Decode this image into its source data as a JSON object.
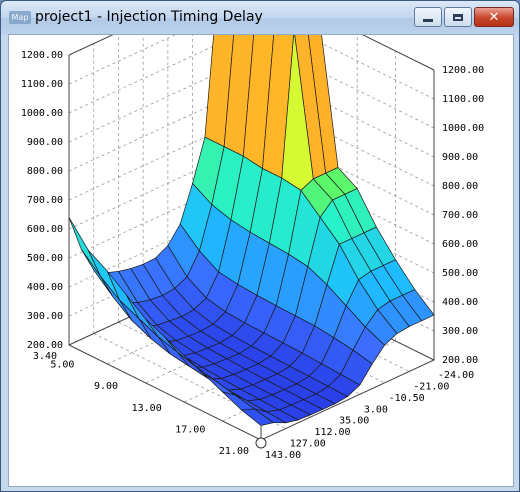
{
  "window": {
    "app_icon_text": "Map",
    "title": "project1 - Injection Timing Delay",
    "controls": {
      "minimize": "minimize",
      "maximize": "maximize",
      "close": "close"
    }
  },
  "chart_data": {
    "type": "surface",
    "title": "",
    "xlabel": "",
    "ylabel": "",
    "zlabel": "",
    "zlim": [
      200,
      1200
    ],
    "grid": true,
    "z_ticks": [
      "200.00",
      "300.00",
      "400.00",
      "500.00",
      "600.00",
      "700.00",
      "800.00",
      "900.00",
      "1000.00",
      "1100.00",
      "1200.00"
    ],
    "x_ticks": [
      "3.40",
      "5.00",
      "9.00",
      "13.00",
      "17.00",
      "21.00"
    ],
    "y_ticks": [
      "143.00",
      "127.00",
      "112.00",
      "35.00",
      "3.00",
      "-10.50",
      "-21.00",
      "-24.00"
    ],
    "x": [
      3.4,
      4.2,
      5.0,
      7.0,
      9.0,
      11.0,
      13.0,
      15.0,
      17.0,
      19.0,
      21.0
    ],
    "y": [
      143,
      135,
      127,
      120,
      112,
      74,
      35,
      19,
      3,
      -3.75,
      -10.5,
      -15.75,
      -21,
      -22.5,
      -24
    ],
    "z": [
      [
        640,
        510,
        420,
        390,
        375,
        365,
        360,
        362,
        385,
        440,
        560,
        700,
        1180,
        1195,
        1200
      ],
      [
        560,
        450,
        360,
        320,
        300,
        290,
        285,
        290,
        310,
        380,
        520,
        700,
        1180,
        1195,
        1200
      ],
      [
        520,
        400,
        310,
        270,
        255,
        250,
        245,
        250,
        270,
        340,
        500,
        700,
        1180,
        1195,
        1200
      ],
      [
        470,
        370,
        280,
        250,
        235,
        230,
        228,
        232,
        255,
        330,
        490,
        690,
        1180,
        1195,
        1200
      ],
      [
        420,
        340,
        260,
        235,
        225,
        222,
        220,
        226,
        250,
        325,
        485,
        690,
        1180,
        1195,
        1200
      ],
      [
        390,
        320,
        250,
        228,
        220,
        218,
        216,
        222,
        248,
        322,
        480,
        680,
        700,
        700,
        700
      ],
      [
        360,
        300,
        240,
        222,
        216,
        214,
        214,
        220,
        246,
        320,
        470,
        620,
        660,
        660,
        660
      ],
      [
        330,
        285,
        235,
        218,
        213,
        212,
        212,
        218,
        244,
        318,
        440,
        560,
        560,
        560,
        560
      ],
      [
        300,
        270,
        230,
        215,
        211,
        210,
        210,
        216,
        240,
        310,
        400,
        470,
        480,
        480,
        480
      ],
      [
        270,
        255,
        225,
        212,
        209,
        208,
        208,
        214,
        236,
        300,
        360,
        400,
        410,
        410,
        410
      ],
      [
        250,
        240,
        220,
        210,
        208,
        207,
        207,
        212,
        232,
        285,
        330,
        350,
        355,
        355,
        355
      ]
    ]
  }
}
